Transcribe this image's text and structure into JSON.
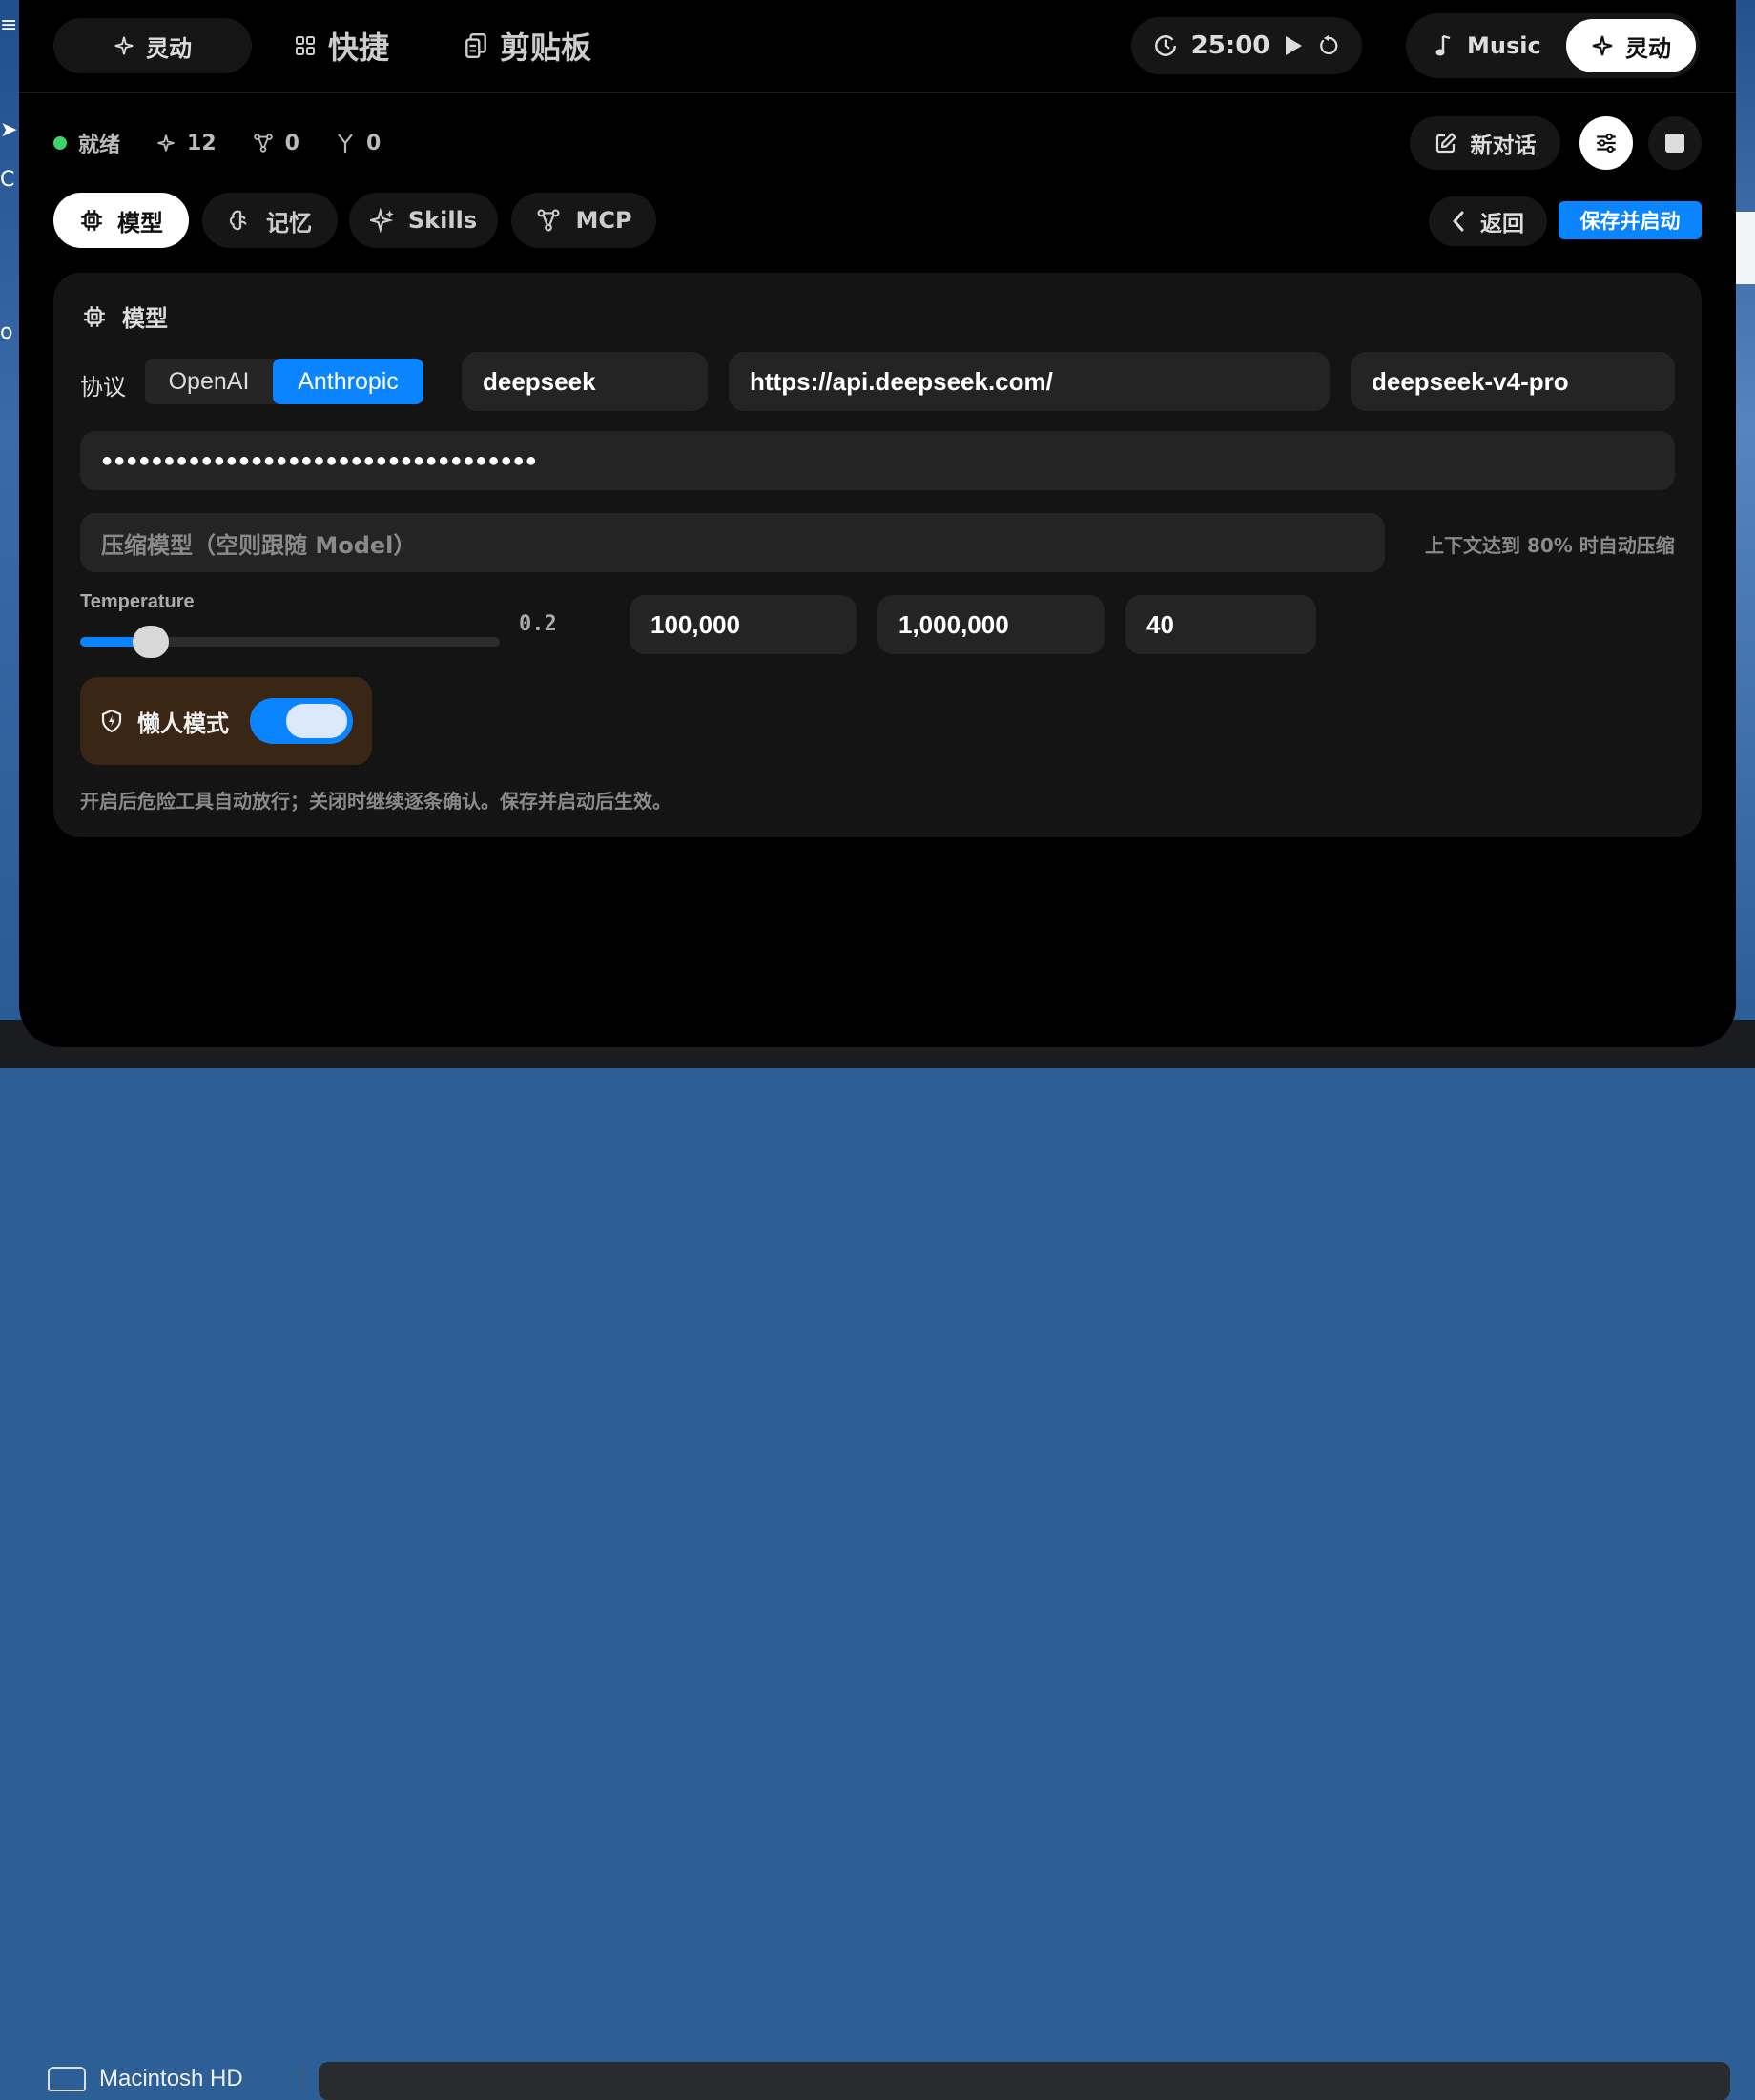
{
  "topbar": {
    "tabs": [
      {
        "label": "灵动",
        "icon": "sparkle-icon"
      },
      {
        "label": "快捷",
        "icon": "grid-icon"
      },
      {
        "label": "剪贴板",
        "icon": "clipboard-icon"
      }
    ],
    "timer": {
      "value": "25:00"
    },
    "mode_switch": {
      "music_label": "Music",
      "active_label": "灵动"
    }
  },
  "status": {
    "state_label": "就绪",
    "state_color": "#3cd36a",
    "skills_count": "12",
    "mcp_count": "0",
    "branch_count": "0"
  },
  "actions": {
    "new_chat_label": "新对话",
    "back_label": "返回",
    "save_label": "保存并启动"
  },
  "config_tabs": [
    {
      "label": "模型",
      "icon": "chip-icon",
      "active": true
    },
    {
      "label": "记忆",
      "icon": "brain-icon",
      "active": false
    },
    {
      "label": "Skills",
      "icon": "sparkle-icon",
      "active": false
    },
    {
      "label": "MCP",
      "icon": "nodes-icon",
      "active": false
    }
  ],
  "model_card": {
    "title": "模型",
    "protocol_label": "协议",
    "protocol_options": [
      "OpenAI",
      "Anthropic"
    ],
    "protocol_selected": "Anthropic",
    "provider": "deepseek",
    "base_url": "https://api.deepseek.com/",
    "model_name": "deepseek-v4-pro",
    "api_key_masked": "●●●●●●●●●●●●●●●●●●●●●●●●●●●●●●●●●●●",
    "compress_placeholder": "压缩模型（空则跟随 Model）",
    "compress_hint": "上下文达到 80% 时自动压缩",
    "temperature_label": "Temperature",
    "temperature_value": "0.2",
    "temperature_fraction": 0.14,
    "max_tokens": "100,000",
    "context_window": "1,000,000",
    "max_steps": "40",
    "lazy_mode_label": "懒人模式",
    "lazy_mode_on": true,
    "lazy_mode_desc": "开启后危险工具自动放行；关闭时继续逐条确认。保存并启动后生效。"
  },
  "finder": {
    "disk_label": "Macintosh HD"
  },
  "colors": {
    "accent": "#0a84ff",
    "lazy_bg": "#3a2614",
    "background": "#000000"
  }
}
